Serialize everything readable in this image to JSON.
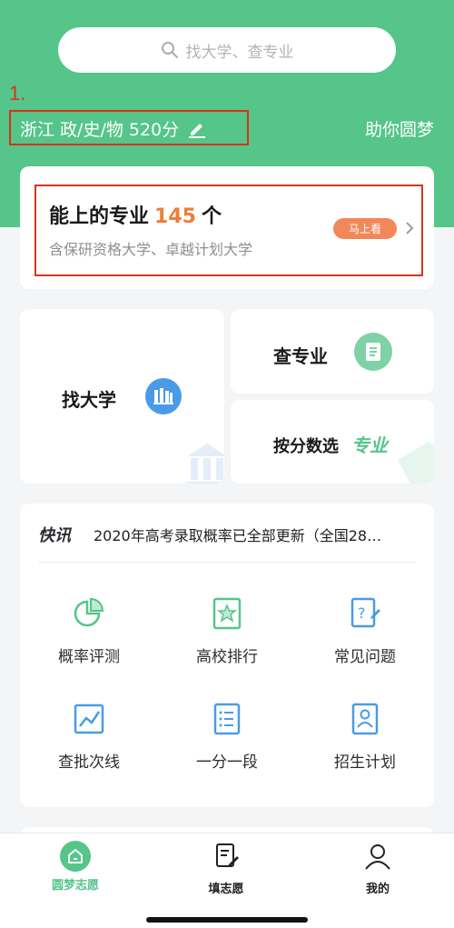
{
  "search": {
    "placeholder": "找大学、查专业",
    "icon": "search-icon"
  },
  "annotation": {
    "number": "1."
  },
  "header": {
    "location": "浙江 政/史/物 520分",
    "edit_icon": "pencil-icon",
    "slogan": "助你圆梦"
  },
  "majors_card": {
    "title_prefix": "能上的专业",
    "count": "145",
    "title_suffix": "个",
    "subtitle": "含保研资格大学、卓越计划大学",
    "action_label": "马上看",
    "action_color": "#f2885a",
    "chevron_icon": "chevron-right-icon"
  },
  "tiles": {
    "find_university": {
      "label": "找大学",
      "icon": "library-icon"
    },
    "check_major": {
      "label": "查专业",
      "icon": "book-icon"
    },
    "score_select": {
      "label": "按分数选",
      "badge": "专业"
    }
  },
  "news": {
    "logo": "快讯",
    "text": "2020年高考录取概率已全部更新（全国28…"
  },
  "grid": [
    {
      "label": "概率评测",
      "icon": "pie-chart-icon"
    },
    {
      "label": "高校排行",
      "icon": "ranking-star-icon"
    },
    {
      "label": "常见问题",
      "icon": "question-doc-icon"
    },
    {
      "label": "查批次线",
      "icon": "line-chart-icon"
    },
    {
      "label": "一分一段",
      "icon": "list-doc-icon"
    },
    {
      "label": "招生计划",
      "icon": "profile-card-icon"
    }
  ],
  "tabbar": [
    {
      "label": "圆梦志愿",
      "icon": "home-icon",
      "active": true
    },
    {
      "label": "填志愿",
      "icon": "edit-form-icon",
      "active": false
    },
    {
      "label": "我的",
      "icon": "user-icon",
      "active": false
    }
  ],
  "colors": {
    "brand_green": "#55c58a",
    "accent_orange": "#ef7d3a",
    "icon_blue": "#4a9be6",
    "annotation_red": "#d8331c"
  }
}
